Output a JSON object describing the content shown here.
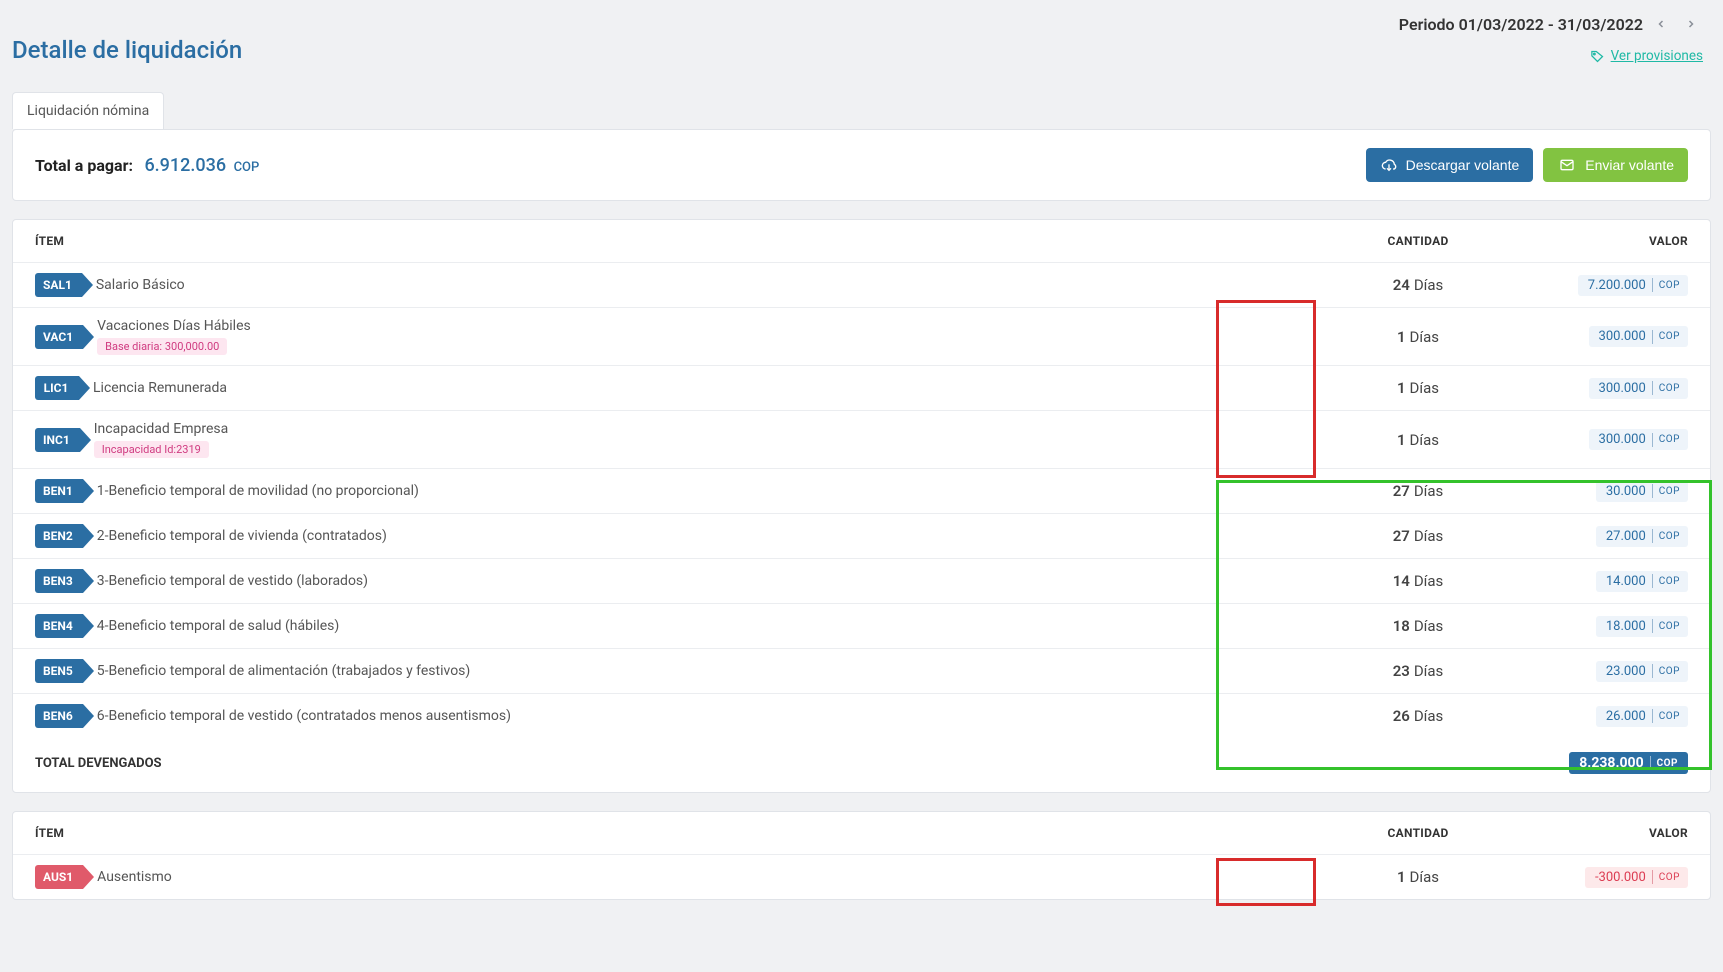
{
  "header": {
    "title": "Detalle de liquidación",
    "period_label": "Periodo 01/03/2022 - 31/03/2022",
    "provisiones_link": "Ver provisiones"
  },
  "tabs": {
    "main": "Liquidación nómina"
  },
  "summary": {
    "label": "Total a pagar:",
    "amount": "6.912.036",
    "currency": "COP"
  },
  "buttons": {
    "download": "Descargar volante",
    "send": "Enviar volante"
  },
  "columns": {
    "item": "ÍTEM",
    "cantidad": "CANTIDAD",
    "valor": "VALOR"
  },
  "unit": "Días",
  "currency_short": "COP",
  "devengados": {
    "rows": [
      {
        "code": "SAL1",
        "desc": "Salario Básico",
        "qty": "24",
        "value": "7.200.000"
      },
      {
        "code": "VAC1",
        "desc": "Vacaciones Días Hábiles",
        "sub": "Base diaria: 300,000.00",
        "qty": "1",
        "value": "300.000"
      },
      {
        "code": "LIC1",
        "desc": "Licencia Remunerada",
        "qty": "1",
        "value": "300.000"
      },
      {
        "code": "INC1",
        "desc": "Incapacidad Empresa",
        "sub": "Incapacidad Id:2319",
        "qty": "1",
        "value": "300.000"
      },
      {
        "code": "BEN1",
        "desc": "1-Beneficio temporal de movilidad (no proporcional)",
        "qty": "27",
        "value": "30.000"
      },
      {
        "code": "BEN2",
        "desc": "2-Beneficio temporal de vivienda (contratados)",
        "qty": "27",
        "value": "27.000"
      },
      {
        "code": "BEN3",
        "desc": "3-Beneficio temporal de vestido (laborados)",
        "qty": "14",
        "value": "14.000"
      },
      {
        "code": "BEN4",
        "desc": "4-Beneficio temporal de salud (hábiles)",
        "qty": "18",
        "value": "18.000"
      },
      {
        "code": "BEN5",
        "desc": "5-Beneficio temporal de alimentación (trabajados y festivos)",
        "qty": "23",
        "value": "23.000"
      },
      {
        "code": "BEN6",
        "desc": "6-Beneficio temporal de vestido (contratados menos ausentismos)",
        "qty": "26",
        "value": "26.000"
      }
    ],
    "total_label": "TOTAL DEVENGADOS",
    "total_value": "8.238.000"
  },
  "deducciones": {
    "rows": [
      {
        "code": "AUS1",
        "desc": "Ausentismo",
        "qty": "1",
        "value": "-300.000",
        "red": true
      }
    ]
  }
}
